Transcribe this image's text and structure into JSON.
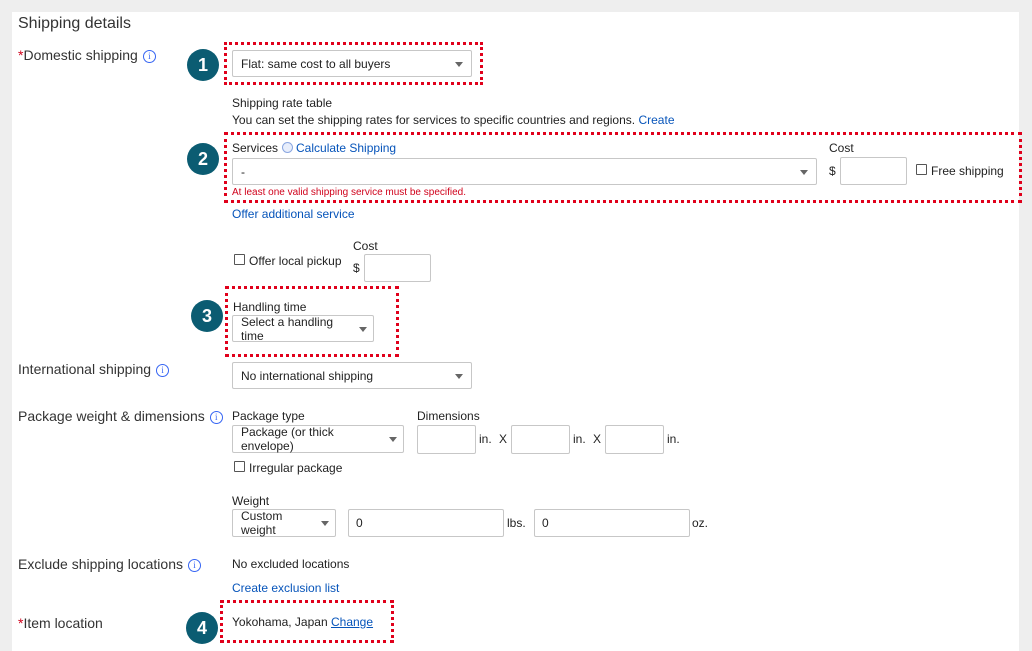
{
  "section_title": "Shipping details",
  "domestic": {
    "required_mark": "*",
    "label": "Domestic shipping",
    "info": "i",
    "type_value": "Flat: same cost to all buyers",
    "rate_table_title": "Shipping rate table",
    "rate_table_desc": "You can set the shipping rates for services to specific countries and regions.",
    "rate_table_link": "Create",
    "services_label": "Services",
    "calc_link": "Calculate Shipping",
    "service_value": "-",
    "cost_label": "Cost",
    "currency": "$",
    "cost_value": "",
    "free_shipping_label": "Free shipping",
    "error_text": "At least one valid shipping service must be specified.",
    "offer_additional": "Offer additional service",
    "local_pickup_label": "Offer local pickup",
    "local_cost_label": "Cost",
    "local_currency": "$",
    "local_cost_value": "",
    "handling_label": "Handling time",
    "handling_value": "Select a handling time"
  },
  "international": {
    "label": "International shipping",
    "info": "i",
    "value": "No international shipping"
  },
  "package": {
    "label": "Package weight & dimensions",
    "info": "i",
    "type_label": "Package type",
    "type_value": "Package (or thick envelope)",
    "dimensions_label": "Dimensions",
    "dim1": "",
    "dim2": "",
    "dim3": "",
    "unit_in": "in.",
    "times": "X",
    "irregular_label": "Irregular package",
    "weight_label": "Weight",
    "weight_type": "Custom weight",
    "lbs_value": "0",
    "lbs_unit": "lbs.",
    "oz_value": "0",
    "oz_unit": "oz."
  },
  "exclude": {
    "label": "Exclude shipping locations",
    "info": "i",
    "value": "No excluded locations",
    "create_link": "Create exclusion list"
  },
  "location": {
    "required_mark": "*",
    "label": "Item location",
    "value": "Yokohama, Japan",
    "change_link": "Change"
  },
  "callouts": [
    "1",
    "2",
    "3",
    "4"
  ],
  "colors": {
    "callout_bg": "#0b5c72",
    "highlight": "#e0001b",
    "link": "#0654ba"
  }
}
